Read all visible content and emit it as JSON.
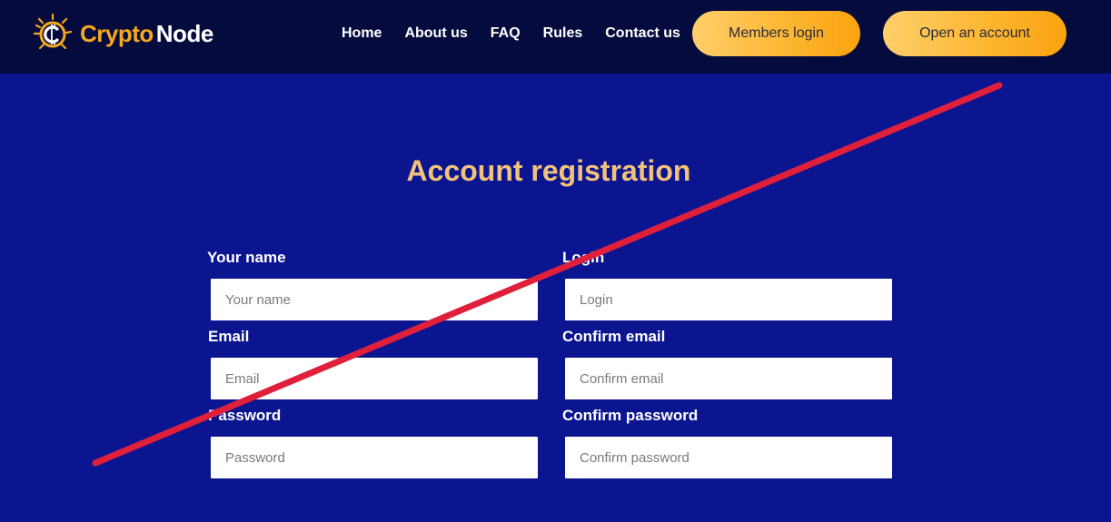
{
  "logo": {
    "part1": "Crypto",
    "part2": "Node",
    "icon": "bitcoin-coin-icon"
  },
  "nav": {
    "items": [
      "Home",
      "About us",
      "FAQ",
      "Rules",
      "Contact us"
    ]
  },
  "buttons": {
    "members_login": "Members login",
    "open_account": "Open an account"
  },
  "page": {
    "title": "Account registration"
  },
  "form": {
    "your_name": {
      "label": "Your name",
      "placeholder": "Your name",
      "value": ""
    },
    "login": {
      "label": "Login",
      "placeholder": "Login",
      "value": ""
    },
    "email": {
      "label": "Email",
      "placeholder": "Email",
      "value": ""
    },
    "confirm_email": {
      "label": "Confirm email",
      "placeholder": "Confirm email",
      "value": ""
    },
    "password": {
      "label": "Password",
      "placeholder": "Password",
      "value": ""
    },
    "confirm_password": {
      "label": "Confirm password",
      "placeholder": "Confirm password",
      "value": ""
    }
  },
  "colors": {
    "header_bg": "#060b3d",
    "page_bg": "#0c1590",
    "accent": "#f4a81d",
    "title": "#f2c27a",
    "strike_line": "#e0203a"
  }
}
